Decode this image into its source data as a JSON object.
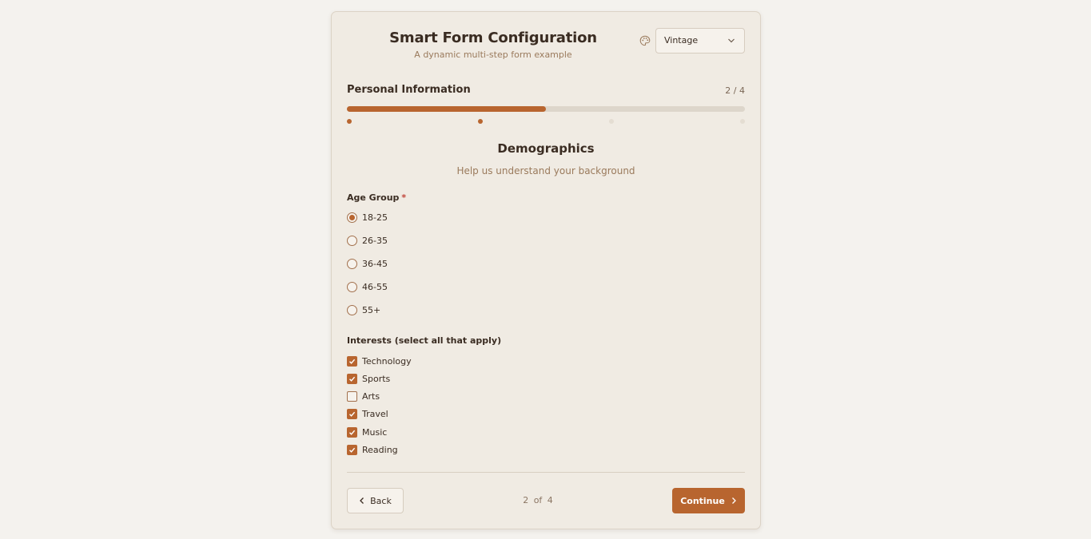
{
  "header": {
    "title": "Smart Form Configuration",
    "subtitle": "A dynamic multi-step form example",
    "theme_value": "Vintage"
  },
  "progress": {
    "step_title": "Personal Information",
    "step_count": "2 / 4",
    "current_step": 2,
    "total_steps": 4,
    "fill_fraction": 0.5
  },
  "section": {
    "title": "Demographics",
    "subtitle": "Help us understand your background"
  },
  "age_group": {
    "label": "Age Group",
    "required_marker": "*",
    "options": [
      "18-25",
      "26-35",
      "36-45",
      "46-55",
      "55+"
    ],
    "selected": "18-25"
  },
  "interests": {
    "label": "Interests (select all that apply)",
    "options": [
      {
        "label": "Technology",
        "checked": true
      },
      {
        "label": "Sports",
        "checked": true
      },
      {
        "label": "Arts",
        "checked": false
      },
      {
        "label": "Travel",
        "checked": true
      },
      {
        "label": "Music",
        "checked": true
      },
      {
        "label": "Reading",
        "checked": true
      }
    ]
  },
  "footer": {
    "back_label": "Back",
    "pager_text": "2 of 4",
    "continue_label": "Continue"
  },
  "colors": {
    "accent": "#b8652f",
    "background": "#f4f2ee",
    "card": "#f0ebe3"
  },
  "icons": {
    "theme": "palette-icon",
    "select": "chevron-down-icon",
    "back": "chevron-left-icon",
    "continue": "chevron-right-icon",
    "check": "check-icon"
  }
}
